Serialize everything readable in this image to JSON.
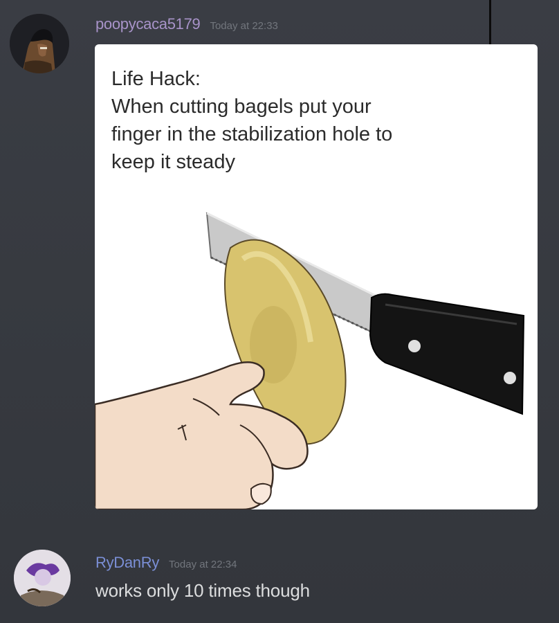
{
  "divider": {},
  "messages": [
    {
      "username": "poopycaca5179",
      "timestamp": "Today at 22:33",
      "avatar_icon": "user-avatar-icon",
      "attachment": {
        "caption_lines": [
          "Life Hack:",
          "When cutting bagels put your",
          "finger in the stabilization hole to",
          "keep it steady"
        ]
      }
    },
    {
      "username": "RyDanRy",
      "timestamp": "Today at 22:34",
      "avatar_icon": "user-avatar-icon",
      "text": "works only 10 times though"
    }
  ],
  "colors": {
    "background": "#36393f",
    "username_1": "#a893c9",
    "username_2": "#7b8fd6",
    "timestamp": "#72767d",
    "message_text": "#dcddde"
  }
}
